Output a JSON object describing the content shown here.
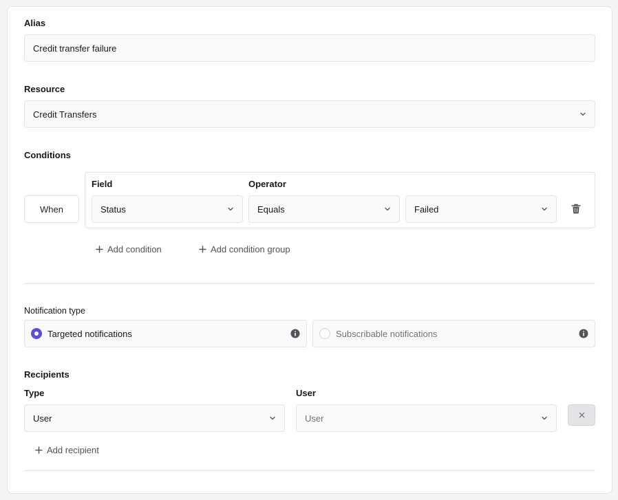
{
  "alias": {
    "label": "Alias",
    "value": "Credit transfer failure"
  },
  "resource": {
    "label": "Resource",
    "value": "Credit Transfers"
  },
  "conditions": {
    "label": "Conditions",
    "when_label": "When",
    "field_label": "Field",
    "operator_label": "Operator",
    "field_value": "Status",
    "operator_value": "Equals",
    "value_value": "Failed",
    "add_condition": "Add condition",
    "add_condition_group": "Add condition group"
  },
  "notification_type": {
    "label": "Notification type",
    "options": [
      {
        "label": "Targeted notifications",
        "selected": true
      },
      {
        "label": "Subscribable notifications",
        "selected": false
      }
    ]
  },
  "recipients": {
    "label": "Recipients",
    "type_label": "Type",
    "user_label": "User",
    "type_value": "User",
    "user_placeholder": "User",
    "add_recipient": "Add recipient"
  },
  "colors": {
    "accent": "#5b4fd6",
    "border": "#e4e4e7",
    "muted_text": "#71717a"
  }
}
